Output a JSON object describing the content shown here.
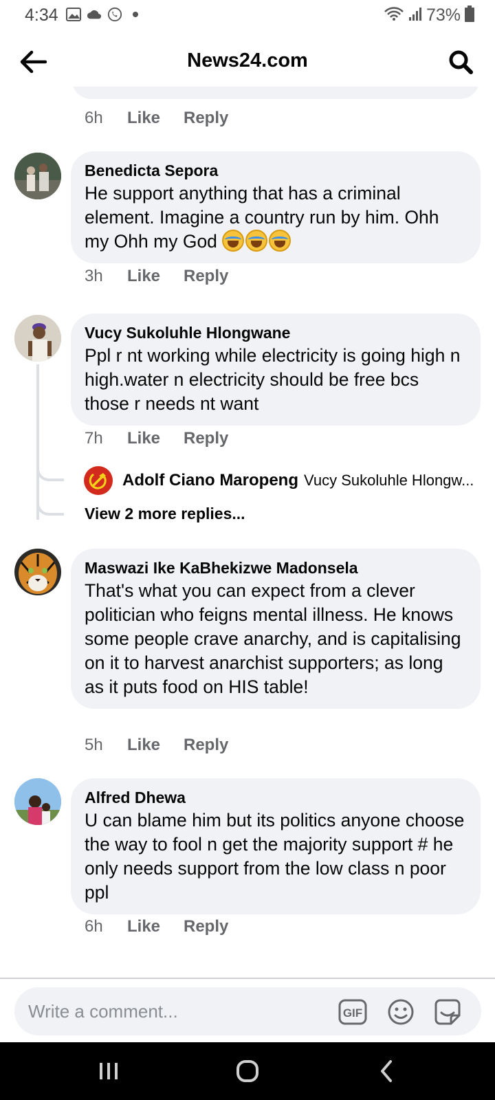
{
  "status_bar": {
    "time": "4:34",
    "battery": "73%"
  },
  "header": {
    "title": "News24.com"
  },
  "previous_comment": {
    "time": "6h",
    "like": "Like",
    "reply": "Reply"
  },
  "comments": [
    {
      "author": "Benedicta Sepora",
      "text": "He support anything that has a criminal element.  Imagine a country run by him. Ohh my Ohh my God",
      "time": "3h",
      "like": "Like",
      "reply": "Reply"
    },
    {
      "author": "Vucy Sukoluhle Hlongwane",
      "text": "Ppl r nt working while electricity is going high n high.water n electricity should be free bcs those r needs nt want",
      "time": "7h",
      "like": "Like",
      "reply": "Reply",
      "reply_preview": {
        "author": "Adolf Ciano Maropeng",
        "text": "Vucy Sukoluhle Hlongw..."
      },
      "view_more": "View 2 more replies..."
    },
    {
      "author": "Maswazi Ike KaBhekizwe Madonsela",
      "text": "That's what you can expect from a clever politician who feigns mental illness. He knows some people crave anarchy, and is capitalising on it to harvest anarchist supporters; as long as it puts food on HIS table!",
      "time": "5h",
      "like": "Like",
      "reply": "Reply"
    },
    {
      "author": "Alfred Dhewa",
      "text": "U can blame him but its politics   anyone choose the way to fool n get the majority support # he only needs support from the low class n poor ppl",
      "time": "6h",
      "like": "Like",
      "reply": "Reply"
    }
  ],
  "composer": {
    "placeholder": "Write a comment...",
    "gif_label": "GIF"
  }
}
